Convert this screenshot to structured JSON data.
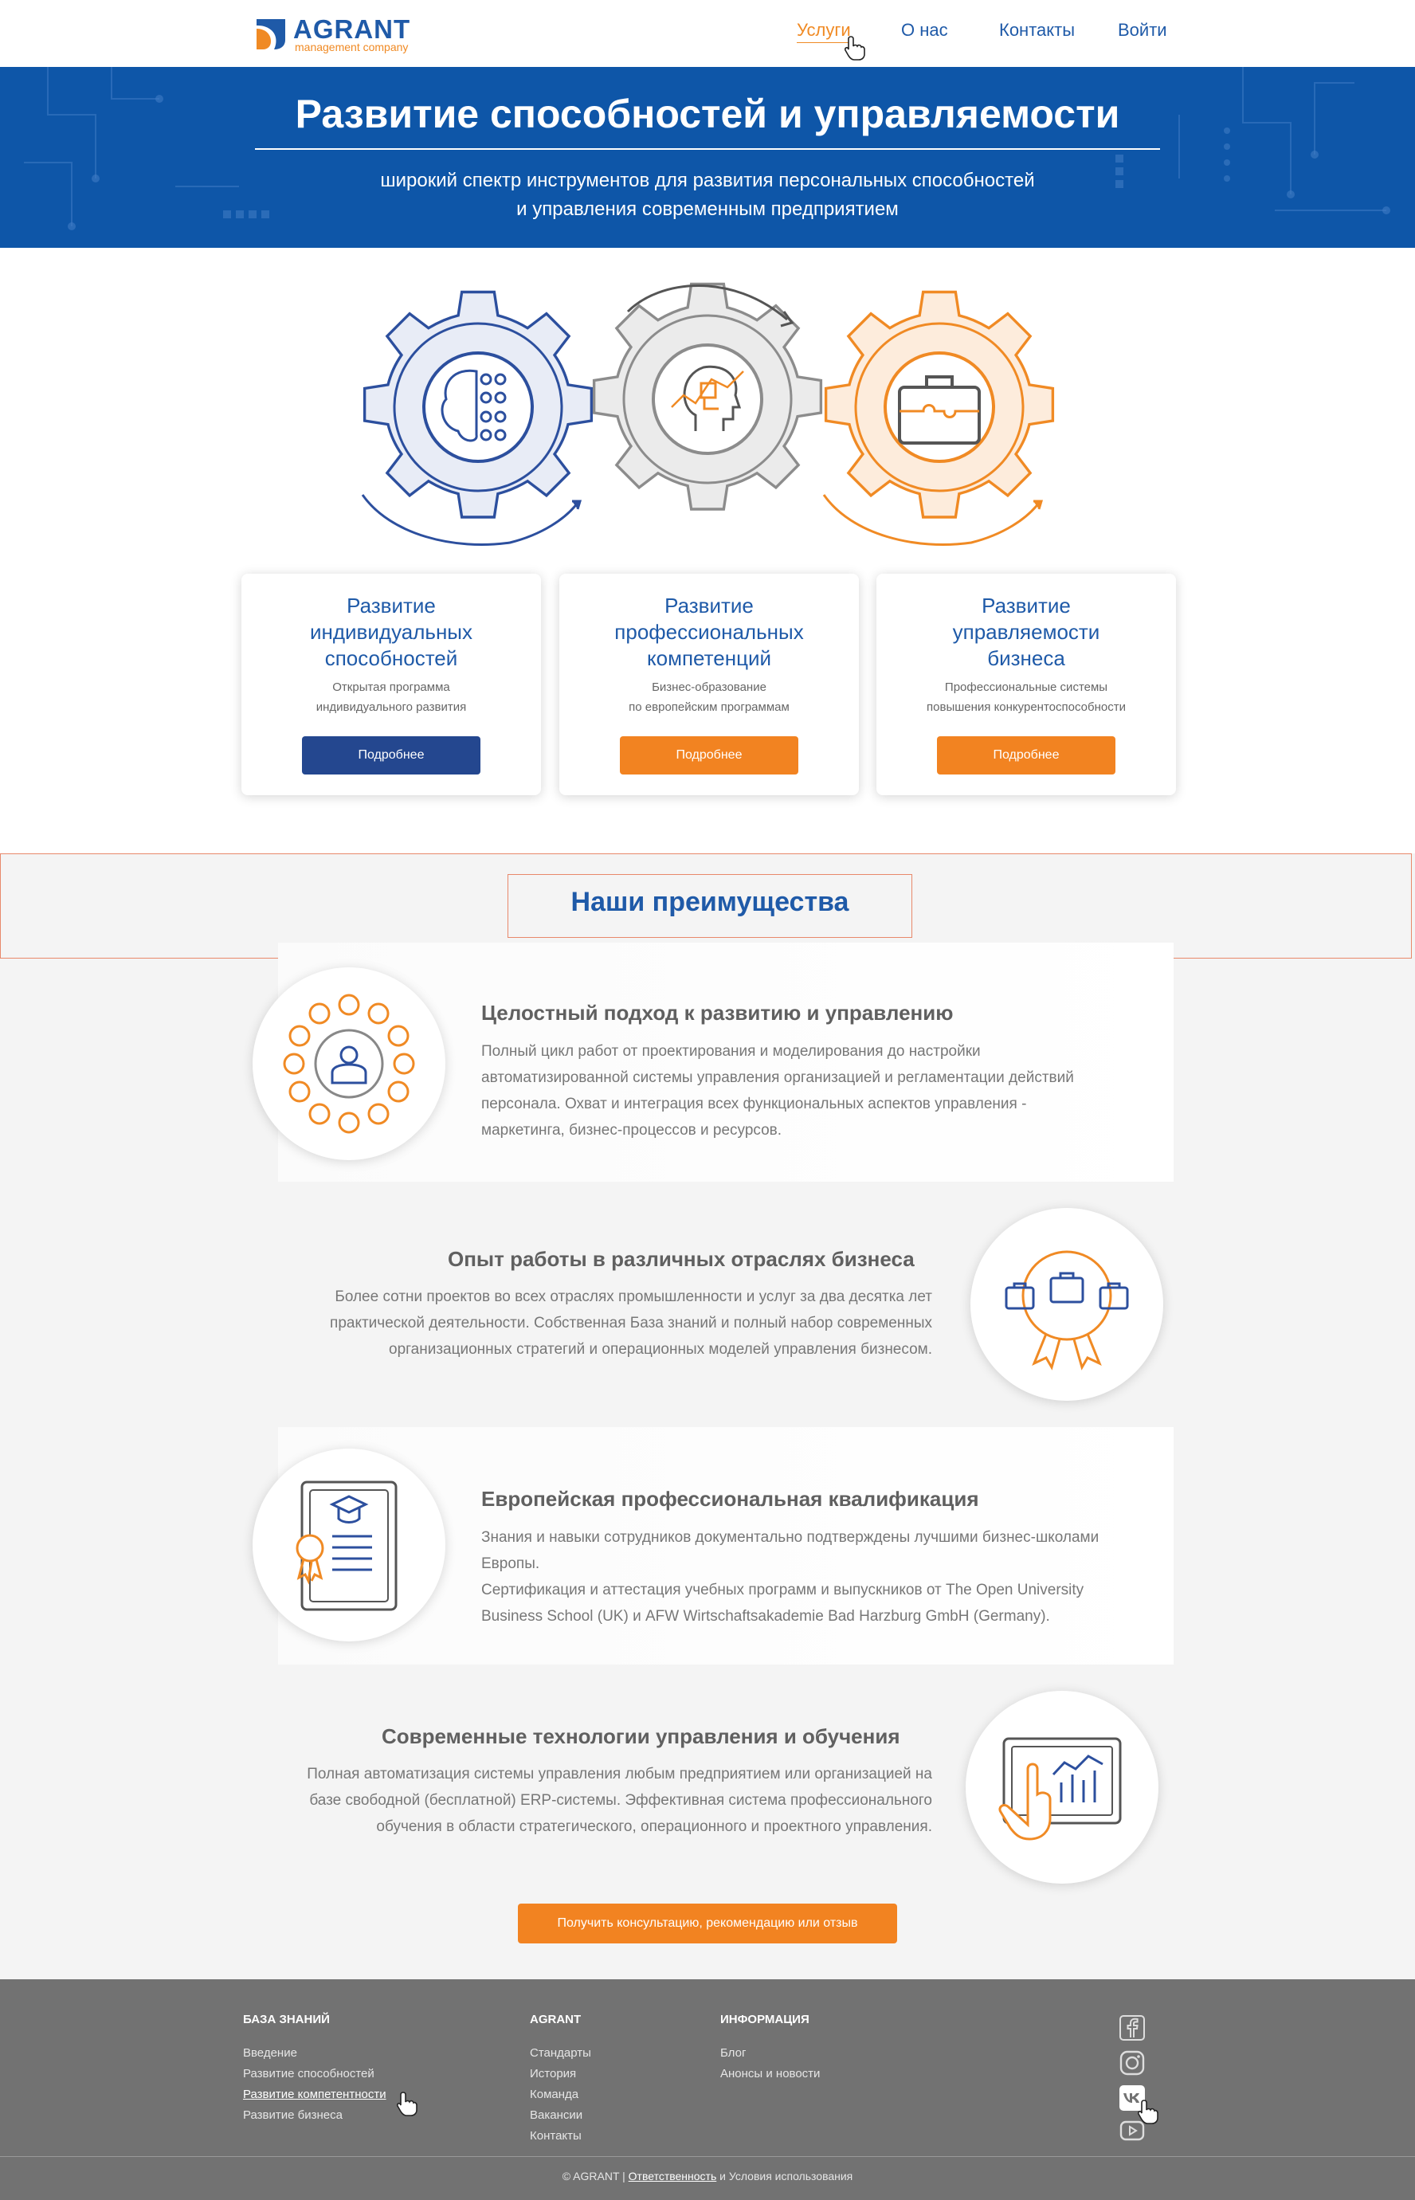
{
  "header": {
    "logo_word": "AGRANT",
    "logo_sub": "management company",
    "nav": [
      "Услуги",
      "О нас",
      "Контакты",
      "Войти"
    ]
  },
  "hero": {
    "title": "Развитие способностей и управляемости",
    "subtitle_line1": "широкий спектр инструментов для развития персональных способностей",
    "subtitle_line2": "и управления современным предприятием"
  },
  "cards": [
    {
      "title_lines": [
        "Развитие",
        "индивидуальных",
        "способностей"
      ],
      "desc_lines": [
        "Открытая программа",
        "индивидуального развития"
      ],
      "button": "Подробнее",
      "color": "#24478f"
    },
    {
      "title_lines": [
        "Развитие",
        "профессиональных",
        "компетенций"
      ],
      "desc_lines": [
        "Бизнес-образование",
        "по европейским программам"
      ],
      "button": "Подробнее",
      "color": "#f28321"
    },
    {
      "title_lines": [
        "Развитие",
        "управляемости",
        "бизнеса"
      ],
      "desc_lines": [
        "Профессиональные системы",
        "повышения конкурентоспособности"
      ],
      "button": "Подробнее",
      "color": "#f28321"
    }
  ],
  "advantages": {
    "title": "Наши преимущества",
    "items": [
      {
        "heading": "Целостный подход к развитию и управлению",
        "lines": [
          "Полный цикл работ от проектирования и моделирования до настройки",
          "автоматизированной системы управления организацией и регламентации действий",
          "персонала. Охват и интеграция всех функциональных аспектов управления -",
          "маркетинга, бизнес-процессов и ресурсов."
        ]
      },
      {
        "heading": "Опыт работы в различных отраслях бизнеса",
        "lines": [
          "Более сотни проектов во всех отраслях промышленности и услуг за два десятка лет",
          "практической деятельности. Собственная База знаний и полный набор современных",
          "организационных стратегий и операционных моделей управления бизнесом."
        ]
      },
      {
        "heading": "Европейская профессиональная квалификация",
        "lines": [
          "Знания и навыки сотрудников документально подтверждены лучшими бизнес-школами",
          "Европы.",
          "Сертификация и аттестация учебных программ и выпускников от The Open University",
          "Business School (UK) и AFW Wirtschaftsakademie Bad Harzburg GmbH (Germany)."
        ]
      },
      {
        "heading": "Современные технологии управления и обучения",
        "lines": [
          "Полная автоматизация системы управления любым предприятием или организацией на",
          "базе свободной (бесплатной) ERP-системы. Эффективная система профессионального",
          "обучения в области стратегического, операционного и проектного управления."
        ]
      }
    ],
    "cta": "Получить консультацию, рекомендацию или отзыв"
  },
  "footer": {
    "col1": {
      "head": "БАЗА ЗНАНИЙ",
      "links": [
        "Введение",
        "Развитие способностей",
        "Развитие компетентности",
        "Развитие бизнеса"
      ]
    },
    "col2": {
      "head": "AGRANT",
      "links": [
        "Стандарты",
        "История",
        "Команда",
        "Вакансии",
        "Контакты"
      ]
    },
    "col3": {
      "head": "ИНФОРМАЦИЯ",
      "links": [
        "Блог",
        "Анонсы и новости"
      ]
    },
    "copy_prefix": "© AGRANT |",
    "copy_link": "Ответственность",
    "copy_mid": "и",
    "copy_suffix": "Условия использования",
    "social": [
      "facebook-icon",
      "instagram-icon",
      "vk-icon",
      "youtube-icon"
    ]
  }
}
